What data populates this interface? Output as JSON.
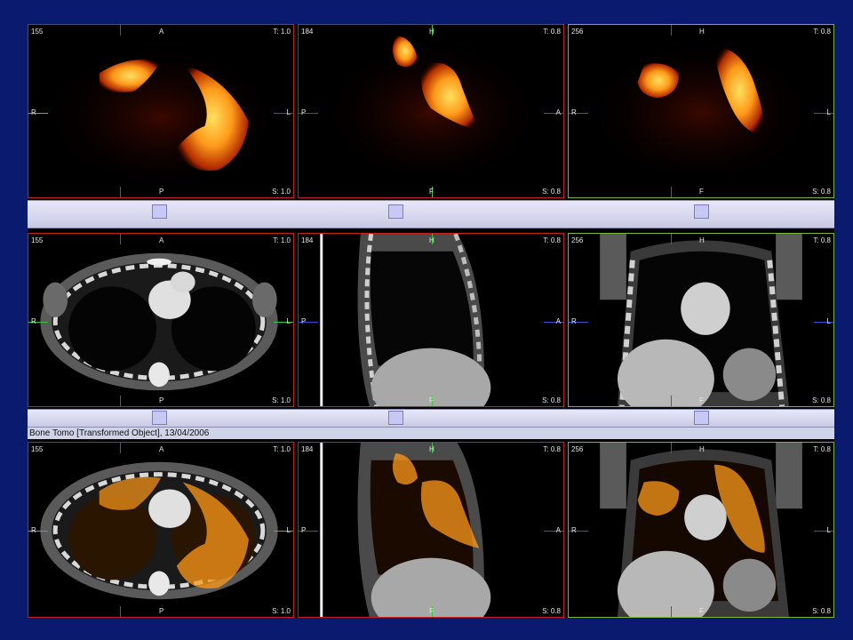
{
  "window": {
    "series_title": "Bone Tomo [Transformed Object], 13/04/2006"
  },
  "rows": [
    {
      "name": "spect",
      "panes": [
        {
          "view": "axial",
          "slice": "155",
          "top": "A",
          "bottom": "P",
          "left": "R",
          "right": "L",
          "t_level": "T: 1.0",
          "s_level": "S: 1.0"
        },
        {
          "view": "sagittal",
          "slice": "184",
          "top": "H",
          "bottom": "F",
          "left": "P",
          "right": "A",
          "t_level": "T: 0.8",
          "s_level": "S: 0.8"
        },
        {
          "view": "coronal",
          "slice": "256",
          "top": "H",
          "bottom": "F",
          "left": "R",
          "right": "L",
          "t_level": "T: 0.8",
          "s_level": "S: 0.8"
        }
      ]
    },
    {
      "name": "ct",
      "panes": [
        {
          "view": "axial",
          "slice": "155",
          "top": "A",
          "bottom": "P",
          "left": "R",
          "right": "L",
          "t_level": "T: 1.0",
          "s_level": "S: 1.0"
        },
        {
          "view": "sagittal",
          "slice": "184",
          "top": "H",
          "bottom": "F",
          "left": "P",
          "right": "A",
          "t_level": "T: 0.8",
          "s_level": "S: 0.8"
        },
        {
          "view": "coronal",
          "slice": "256",
          "top": "H",
          "bottom": "F",
          "left": "R",
          "right": "L",
          "t_level": "T: 0.8",
          "s_level": "S: 0.8"
        }
      ]
    },
    {
      "name": "fused",
      "panes": [
        {
          "view": "axial",
          "slice": "155",
          "top": "A",
          "bottom": "P",
          "left": "R",
          "right": "L",
          "t_level": "T: 1.0",
          "s_level": "S: 1.0"
        },
        {
          "view": "sagittal",
          "slice": "184",
          "top": "H",
          "bottom": "F",
          "left": "P",
          "right": "A",
          "t_level": "T: 0.8",
          "s_level": "S: 0.8"
        },
        {
          "view": "coronal",
          "slice": "256",
          "top": "H",
          "bottom": "F",
          "left": "R",
          "right": "L",
          "t_level": "T: 0.8",
          "s_level": "S: 0.8"
        }
      ]
    }
  ],
  "colors": {
    "background": "#0a1a6e",
    "axial_border": "#c02020",
    "coronal_border": "#7ab43a",
    "hot_colormap": "#ff9a1a"
  }
}
